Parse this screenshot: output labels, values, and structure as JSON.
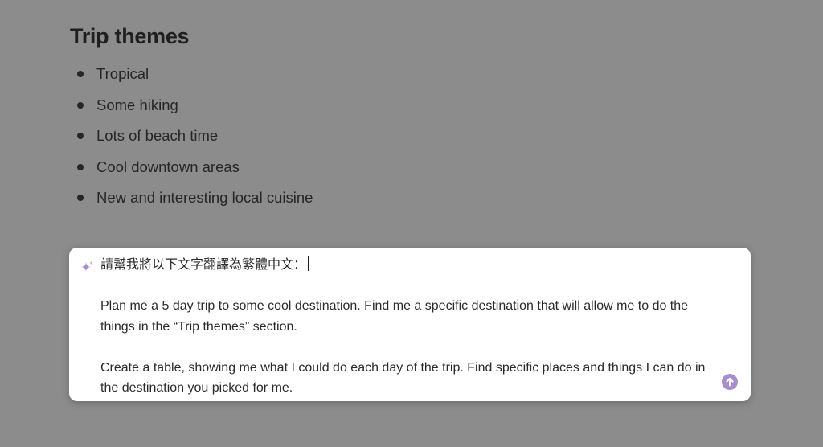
{
  "page": {
    "heading": "Trip themes",
    "bullets": [
      "Tropical",
      "Some hiking",
      "Lots of beach time",
      "Cool downtown areas",
      "New and interesting local cuisine"
    ]
  },
  "prompt": {
    "icon": "sparkle-icon",
    "instruction": "請幫我將以下文字翻譯為繁體中文：",
    "paragraphs": [
      "Plan me a 5 day trip to some cool destination. Find me a specific destination that will allow me to do the things in the “Trip themes” section.",
      "Create a table, showing me what I could do each day of the trip. Find specific places and things I can do in the destination you picked for me."
    ],
    "send_icon": "arrow-up-icon",
    "accent_color": "#a98bd1"
  }
}
